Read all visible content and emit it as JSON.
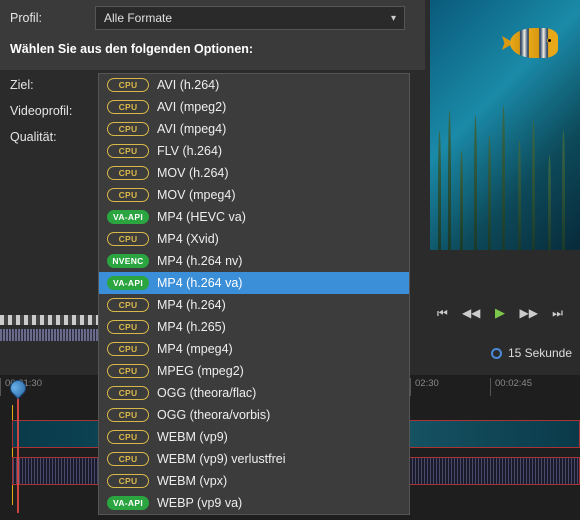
{
  "profile_label": "Profil:",
  "profile_value": "Alle Formate",
  "section_header": "Wählen Sie aus den folgenden Optionen:",
  "labels": {
    "target": "Ziel:",
    "videoprofile": "Videoprofil:",
    "quality": "Qualität:"
  },
  "formats": [
    {
      "badge": "CPU",
      "badge_type": "cpu",
      "label": "AVI (h.264)"
    },
    {
      "badge": "CPU",
      "badge_type": "cpu",
      "label": "AVI (mpeg2)"
    },
    {
      "badge": "CPU",
      "badge_type": "cpu",
      "label": "AVI (mpeg4)"
    },
    {
      "badge": "CPU",
      "badge_type": "cpu",
      "label": "FLV (h.264)"
    },
    {
      "badge": "CPU",
      "badge_type": "cpu",
      "label": "MOV (h.264)"
    },
    {
      "badge": "CPU",
      "badge_type": "cpu",
      "label": "MOV (mpeg4)"
    },
    {
      "badge": "VA-API",
      "badge_type": "vaapi",
      "label": "MP4 (HEVC va)"
    },
    {
      "badge": "CPU",
      "badge_type": "cpu",
      "label": "MP4 (Xvid)"
    },
    {
      "badge": "NVENC",
      "badge_type": "nvenc",
      "label": "MP4 (h.264 nv)"
    },
    {
      "badge": "VA-API",
      "badge_type": "vaapi",
      "label": "MP4 (h.264 va)",
      "selected": true
    },
    {
      "badge": "CPU",
      "badge_type": "cpu",
      "label": "MP4 (h.264)"
    },
    {
      "badge": "CPU",
      "badge_type": "cpu",
      "label": "MP4 (h.265)"
    },
    {
      "badge": "CPU",
      "badge_type": "cpu",
      "label": "MP4 (mpeg4)"
    },
    {
      "badge": "CPU",
      "badge_type": "cpu",
      "label": "MPEG (mpeg2)"
    },
    {
      "badge": "CPU",
      "badge_type": "cpu",
      "label": "OGG (theora/flac)"
    },
    {
      "badge": "CPU",
      "badge_type": "cpu",
      "label": "OGG (theora/vorbis)"
    },
    {
      "badge": "CPU",
      "badge_type": "cpu",
      "label": "WEBM (vp9)"
    },
    {
      "badge": "CPU",
      "badge_type": "cpu",
      "label": "WEBM (vp9) verlustfrei"
    },
    {
      "badge": "CPU",
      "badge_type": "cpu",
      "label": "WEBM (vpx)"
    },
    {
      "badge": "VA-API",
      "badge_type": "vaapi",
      "label": "WEBP (vp9 va)"
    }
  ],
  "playback": {
    "skip_start": "⏮",
    "rewind": "◀◀",
    "play": "▶",
    "forward": "▶▶",
    "skip_end": "⏭"
  },
  "status_text": "15 Sekunde",
  "timestamps": [
    "00:01:30",
    "02:30",
    "00:02:45"
  ]
}
